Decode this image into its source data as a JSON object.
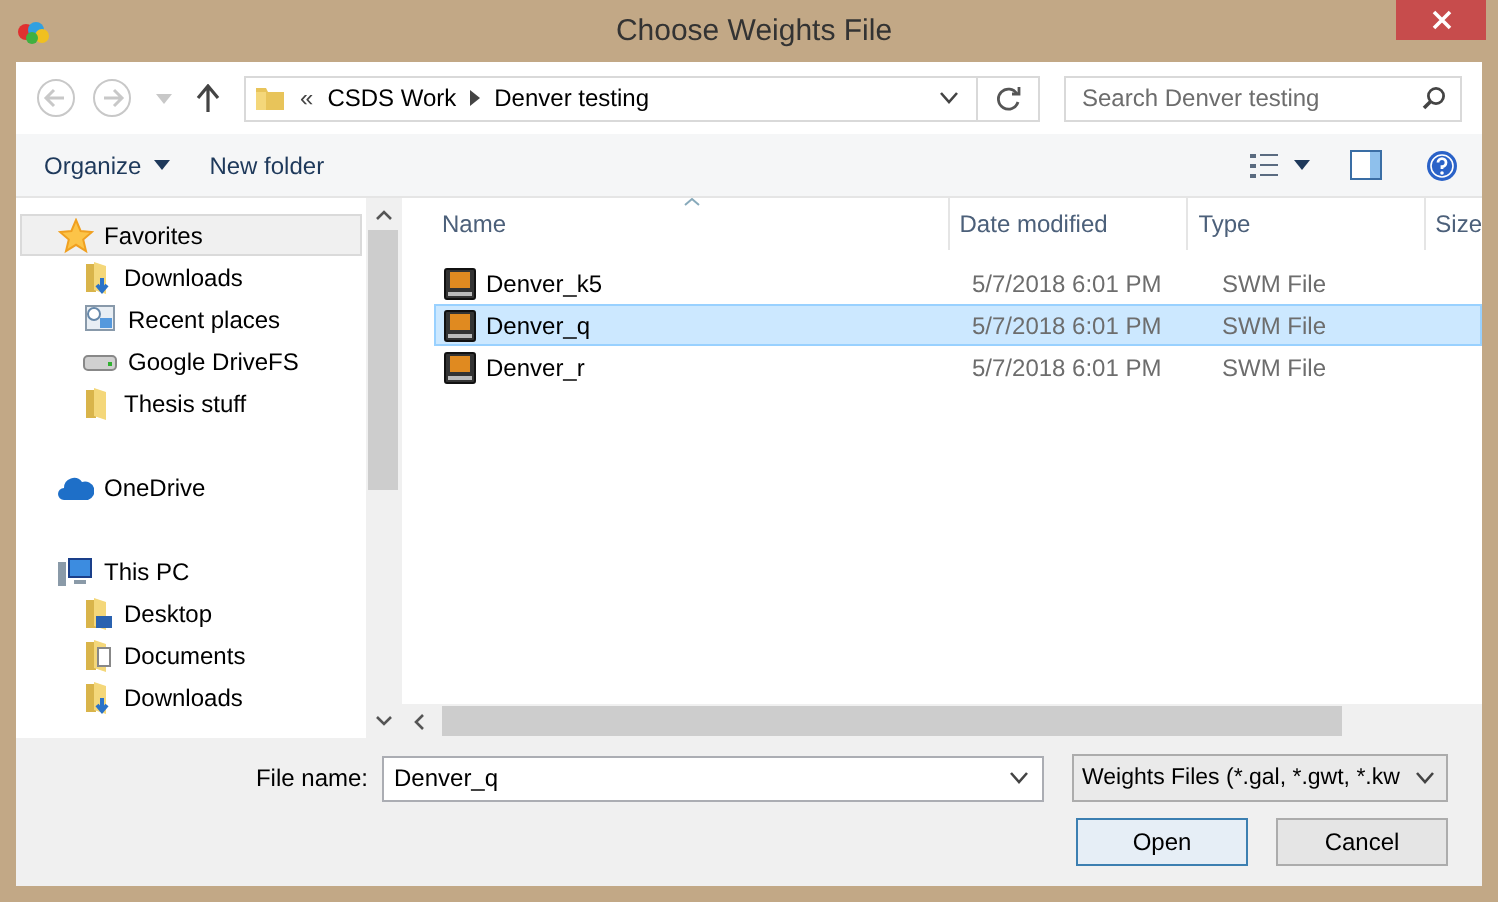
{
  "window": {
    "title": "Choose Weights File"
  },
  "address": {
    "crumbs": [
      "CSDS Work",
      "Denver testing"
    ],
    "overflow": "«"
  },
  "search": {
    "placeholder": "Search Denver testing"
  },
  "toolbar": {
    "organize": "Organize",
    "new_folder": "New folder"
  },
  "sidebar": {
    "sections": [
      {
        "label": "Favorites",
        "selected": true,
        "children": [
          {
            "label": "Downloads",
            "selected": false
          },
          {
            "label": "Recent places",
            "selected": false
          },
          {
            "label": "Google DriveFS",
            "selected": false
          },
          {
            "label": "Thesis stuff",
            "selected": false
          }
        ]
      },
      {
        "label": "OneDrive",
        "selected": false
      },
      {
        "label": "This PC",
        "selected": false,
        "children": [
          {
            "label": "Desktop",
            "selected": false
          },
          {
            "label": "Documents",
            "selected": false
          },
          {
            "label": "Downloads",
            "selected": false
          }
        ]
      }
    ]
  },
  "table": {
    "columns": [
      "Name",
      "Date modified",
      "Type",
      "Size"
    ],
    "rows": [
      {
        "name": "Denver_k5",
        "date": "5/7/2018 6:01 PM",
        "type": "SWM File",
        "selected": false
      },
      {
        "name": "Denver_q",
        "date": "5/7/2018 6:01 PM",
        "type": "SWM File",
        "selected": true
      },
      {
        "name": "Denver_r",
        "date": "5/7/2018 6:01 PM",
        "type": "SWM File",
        "selected": false
      }
    ]
  },
  "file_name": {
    "label": "File name:",
    "value": "Denver_q"
  },
  "file_type": {
    "value": "Weights Files (*.gal, *.gwt, *.kw"
  },
  "buttons": {
    "open": "Open",
    "cancel": "Cancel"
  }
}
